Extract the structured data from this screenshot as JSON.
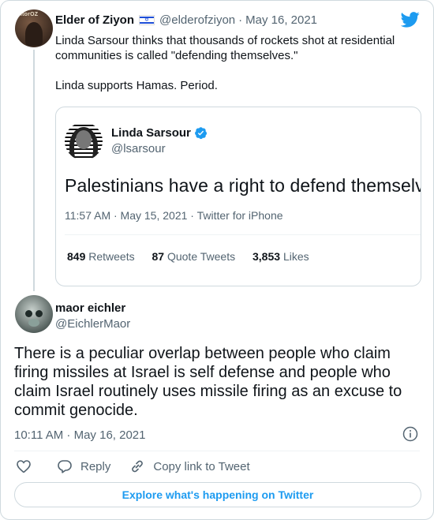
{
  "colors": {
    "twitter_blue": "#1d9bf0",
    "text_primary": "#0f1419",
    "text_secondary": "#536471",
    "border": "#cfd9de"
  },
  "parent_tweet": {
    "avatar_label": "itorOZ",
    "name": "Elder of Ziyon",
    "flag": "israel-flag-icon",
    "handle": "@elderofziyon",
    "separator": "·",
    "date": "May 16, 2021",
    "text_line1": "Linda Sarsour thinks that thousands of rockets shot at residential communities is called \"defending themselves.\"",
    "text_line2": "Linda supports Hamas. Period."
  },
  "quoted_tweet": {
    "name": "Linda Sarsour",
    "handle": "@lsarsour",
    "text": "Palestinians have a right to defend themselves",
    "meta": "11:57 AM · May 15, 2021 · Twitter for iPhone",
    "retweets_count": "849",
    "retweets_label": "Retweets",
    "quotes_count": "87",
    "quotes_label": "Quote Tweets",
    "likes_count": "3,853",
    "likes_label": "Likes"
  },
  "main_tweet": {
    "name": "maor eichler",
    "handle": "@EichlerMaor",
    "text": "There is a peculiar overlap between people who claim firing missiles at Israel is self defense and people who claim Israel routinely uses missile firing as an excuse to commit genocide.",
    "meta": "10:11 AM · May 16, 2021"
  },
  "actions": {
    "reply_label": "Reply",
    "copy_label": "Copy link to Tweet"
  },
  "explore_label": "Explore what's happening on Twitter"
}
